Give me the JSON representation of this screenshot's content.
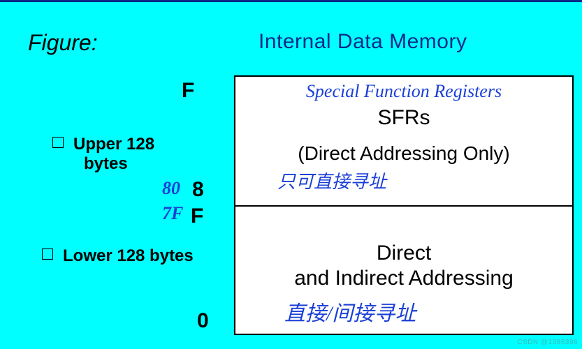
{
  "figure_label": "Figure:",
  "title": "Internal Data Memory",
  "left": {
    "upper_label": "Upper 128",
    "upper_label2": "bytes",
    "lower_label": "Lower 128 bytes"
  },
  "addresses": {
    "ff": "F",
    "eighty": "8",
    "eighty_hand": "80",
    "seven_f": "F",
    "seven_f_hand": "7F",
    "zero": "0"
  },
  "mem": {
    "upper": {
      "hand_note": "Special  Function   Registers",
      "sfrs": "SFRs",
      "direct_only": "(Direct Addressing Only)",
      "direct_only_hand": "只可直接寻址"
    },
    "lower": {
      "line1": "Direct",
      "line2": "and Indirect Addressing",
      "hand": "直接/间接寻址"
    }
  },
  "watermark": "CSDN @1386396"
}
